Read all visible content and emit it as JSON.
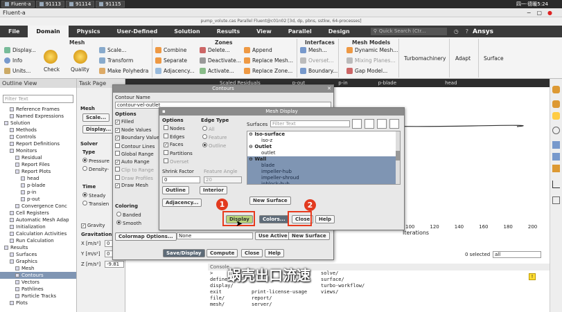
{
  "taskbar": {
    "items": [
      "Fluent-a",
      "91113",
      "91114",
      "91115"
    ],
    "clock": "四一·德暖5:24"
  },
  "window": {
    "title": "Fluent-a",
    "file_line": "pump_volute.cas Parallel Fluent@c01n02  [3d, dp, pbns, sstkw, 64-processes]"
  },
  "ribbon": {
    "tabs": [
      "File",
      "Domain",
      "Physics",
      "User-Defined",
      "Solution",
      "Results",
      "View",
      "Parallel",
      "Design"
    ],
    "active_tab": "Domain",
    "search_placeholder": "Quick Search (Ctr...",
    "brand": "Ansys",
    "groups": {
      "mesh": {
        "title": "Mesh",
        "items": [
          "Display...",
          "Info",
          "Units...",
          "Check",
          "Quality",
          "Scale...",
          "Transform",
          "Make Polyhedra"
        ]
      },
      "zones": {
        "title": "Zones",
        "items": [
          "Combine",
          "Separate",
          "Adjacency...",
          "Delete...",
          "Deactivate...",
          "Activate...",
          "Append",
          "Replace Mesh...",
          "Replace Zone..."
        ]
      },
      "interfaces": {
        "title": "Interfaces",
        "items": [
          "Mesh...",
          "Overset...",
          "Boundary..."
        ]
      },
      "mesh_models": {
        "title": "Mesh Models",
        "items": [
          "Dynamic Mesh...",
          "Mixing Planes...",
          "Gap Model..."
        ]
      },
      "other": [
        "Turbomachinery",
        "Adapt",
        "Surface"
      ]
    }
  },
  "outline": {
    "title": "Outline View",
    "filter_placeholder": "Filter Text",
    "rows": [
      "Reference Frames",
      "Named Expressions",
      "Solution",
      "Methods",
      "Controls",
      "Report Definitions",
      "Monitors",
      "Residual",
      "Report Files",
      "Report Plots",
      "head",
      "p-blade",
      "p-in",
      "p-out",
      "Convergence Conc",
      "Cell Registers",
      "Automatic Mesh Adap",
      "Initialization",
      "Calculation Activities",
      "Run Calculation",
      "Results",
      "Surfaces",
      "Graphics",
      "Mesh",
      "Contours",
      "Vectors",
      "Pathlines",
      "Particle Tracks",
      "Plots"
    ]
  },
  "taskpage": {
    "title": "Task Page",
    "mesh_label": "Mesh",
    "scale_btn": "Scale...",
    "display_btn": "Display...",
    "solver_label": "Solver",
    "type_label": "Type",
    "type_options": [
      "Pressure",
      "Density-"
    ],
    "time_label": "Time",
    "time_options": [
      "Steady",
      "Transien"
    ],
    "gravity": "Gravity",
    "gravitational": "Gravitation",
    "x_label": "X [m/s²]",
    "x_val": "0",
    "y_label": "Y [m/s²]",
    "y_val": "0",
    "z_label": "Z [m/s²]",
    "z_val": "-9.81"
  },
  "graphics": {
    "tabs": [
      "Scaled Residuals",
      "p-out",
      "p-in",
      "p-blade",
      "head"
    ],
    "x_ticks": [
      "100",
      "120",
      "140",
      "160",
      "180",
      "200"
    ],
    "x_label": "Iterations",
    "selected": "0 selected",
    "select_all": "all"
  },
  "contours": {
    "title": "Contours",
    "name_label": "Contour Name",
    "name_value": "contour-vel-outlet",
    "options_label": "Options",
    "options": [
      {
        "label": "Filled",
        "checked": true,
        "disabled": false
      },
      {
        "label": "Node Values",
        "checked": true,
        "disabled": false
      },
      {
        "label": "Boundary Value",
        "checked": true,
        "disabled": false
      },
      {
        "label": "Contour Lines",
        "checked": false,
        "disabled": false
      },
      {
        "label": "Global Range",
        "checked": false,
        "disabled": false
      },
      {
        "label": "Auto Range",
        "checked": true,
        "disabled": false
      },
      {
        "label": "Clip to Range",
        "checked": false,
        "disabled": true
      },
      {
        "label": "Draw Profiles",
        "checked": false,
        "disabled": true
      },
      {
        "label": "Draw Mesh",
        "checked": true,
        "disabled": false
      }
    ],
    "coloring_label": "Coloring",
    "coloring": [
      {
        "label": "Banded",
        "on": false
      },
      {
        "label": "Smooth",
        "on": true
      }
    ],
    "colormap_btn": "Colormap Options...",
    "none_value": "None",
    "use_active": "Use Active",
    "new_surface": "New Surface",
    "buttons": [
      "Save/Display",
      "Compute",
      "Close",
      "Help"
    ]
  },
  "mesh_display": {
    "title": "Mesh Display",
    "options_label": "Options",
    "options": [
      {
        "label": "Nodes",
        "checked": false,
        "disabled": false
      },
      {
        "label": "Edges",
        "checked": false,
        "disabled": false
      },
      {
        "label": "Faces",
        "checked": true,
        "disabled": false
      },
      {
        "label": "Partitions",
        "checked": false,
        "disabled": false
      },
      {
        "label": "Overset",
        "checked": false,
        "disabled": true
      }
    ],
    "edge_type_label": "Edge Type",
    "edge_types": [
      {
        "label": "All",
        "on": false
      },
      {
        "label": "Feature",
        "on": false
      },
      {
        "label": "Outline",
        "on": true
      }
    ],
    "surfaces_label": "Surfaces",
    "surfaces_filter_placeholder": "Filter Text",
    "surface_groups": [
      {
        "name": "Iso-surface",
        "items": [
          "iso-z"
        ],
        "selected": false
      },
      {
        "name": "Outlet",
        "items": [
          "outlet"
        ],
        "selected": false
      },
      {
        "name": "Wall",
        "items": [
          "blade",
          "impeller-hub",
          "impeller-shroud",
          "inblock-hub"
        ],
        "selected": true
      }
    ],
    "shrink_label": "Shrink Factor",
    "shrink_value": "0",
    "feature_label": "Feature Angle",
    "feature_value": "20",
    "outline_btn": "Outline",
    "interior_btn": "Interior",
    "adjacency_btn": "Adjacency...",
    "new_surface_btn": "New Surface",
    "buttons": [
      "Display",
      "Colors...",
      "Close",
      "Help"
    ]
  },
  "annotations": {
    "badge1": "1",
    "badge2": "2",
    "subtitle": "蜗壳出口流速"
  },
  "console": {
    "header": "Console",
    "lines": [
      [
        ">",
        "",
        "solve/"
      ],
      [
        "define/",
        "",
        "surface/"
      ],
      [
        "display/",
        "",
        "turbo-workflow/"
      ],
      [
        "exit",
        "print-license-usage",
        "views/"
      ],
      [
        "file/",
        "report/",
        ""
      ],
      [
        "mesh/",
        "server/",
        ""
      ]
    ]
  },
  "colors": {
    "accent": "#e83a1d",
    "ribbon_dark": "#3a3a3a",
    "selection": "#7f95b3",
    "display_btn": "#b9d47a"
  }
}
